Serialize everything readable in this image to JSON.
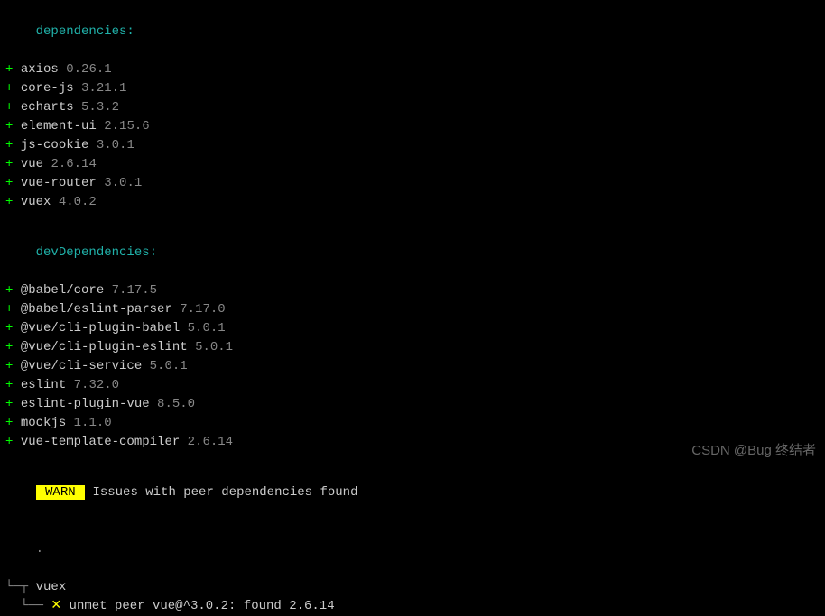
{
  "sections": {
    "dependencies": {
      "label": "dependencies:",
      "items": [
        {
          "plus": "+",
          "name": "axios",
          "version": "0.26.1"
        },
        {
          "plus": "+",
          "name": "core-js",
          "version": "3.21.1"
        },
        {
          "plus": "+",
          "name": "echarts",
          "version": "5.3.2"
        },
        {
          "plus": "+",
          "name": "element-ui",
          "version": "2.15.6"
        },
        {
          "plus": "+",
          "name": "js-cookie",
          "version": "3.0.1"
        },
        {
          "plus": "+",
          "name": "vue",
          "version": "2.6.14"
        },
        {
          "plus": "+",
          "name": "vue-router",
          "version": "3.0.1"
        },
        {
          "plus": "+",
          "name": "vuex",
          "version": "4.0.2"
        }
      ]
    },
    "devDependencies": {
      "label": "devDependencies:",
      "items": [
        {
          "plus": "+",
          "name": "@babel/core",
          "version": "7.17.5"
        },
        {
          "plus": "+",
          "name": "@babel/eslint-parser",
          "version": "7.17.0"
        },
        {
          "plus": "+",
          "name": "@vue/cli-plugin-babel",
          "version": "5.0.1"
        },
        {
          "plus": "+",
          "name": "@vue/cli-plugin-eslint",
          "version": "5.0.1"
        },
        {
          "plus": "+",
          "name": "@vue/cli-service",
          "version": "5.0.1"
        },
        {
          "plus": "+",
          "name": "eslint",
          "version": "7.32.0"
        },
        {
          "plus": "+",
          "name": "eslint-plugin-vue",
          "version": "8.5.0"
        },
        {
          "plus": "+",
          "name": "mockjs",
          "version": "1.1.0"
        },
        {
          "plus": "+",
          "name": "vue-template-compiler",
          "version": "2.6.14"
        }
      ]
    }
  },
  "warning": {
    "badge": " WARN ",
    "message": "Issues with peer dependencies found",
    "dot": ".",
    "tree": {
      "branch1_prefix": "└─┬ ",
      "branch1_name": "vuex",
      "branch2_prefix": "  └── ",
      "branch2_marker": "✕",
      "branch2_text": " unmet peer vue@^3.0.2: found 2.6.14"
    }
  },
  "watermark": "CSDN @Bug 终结者"
}
